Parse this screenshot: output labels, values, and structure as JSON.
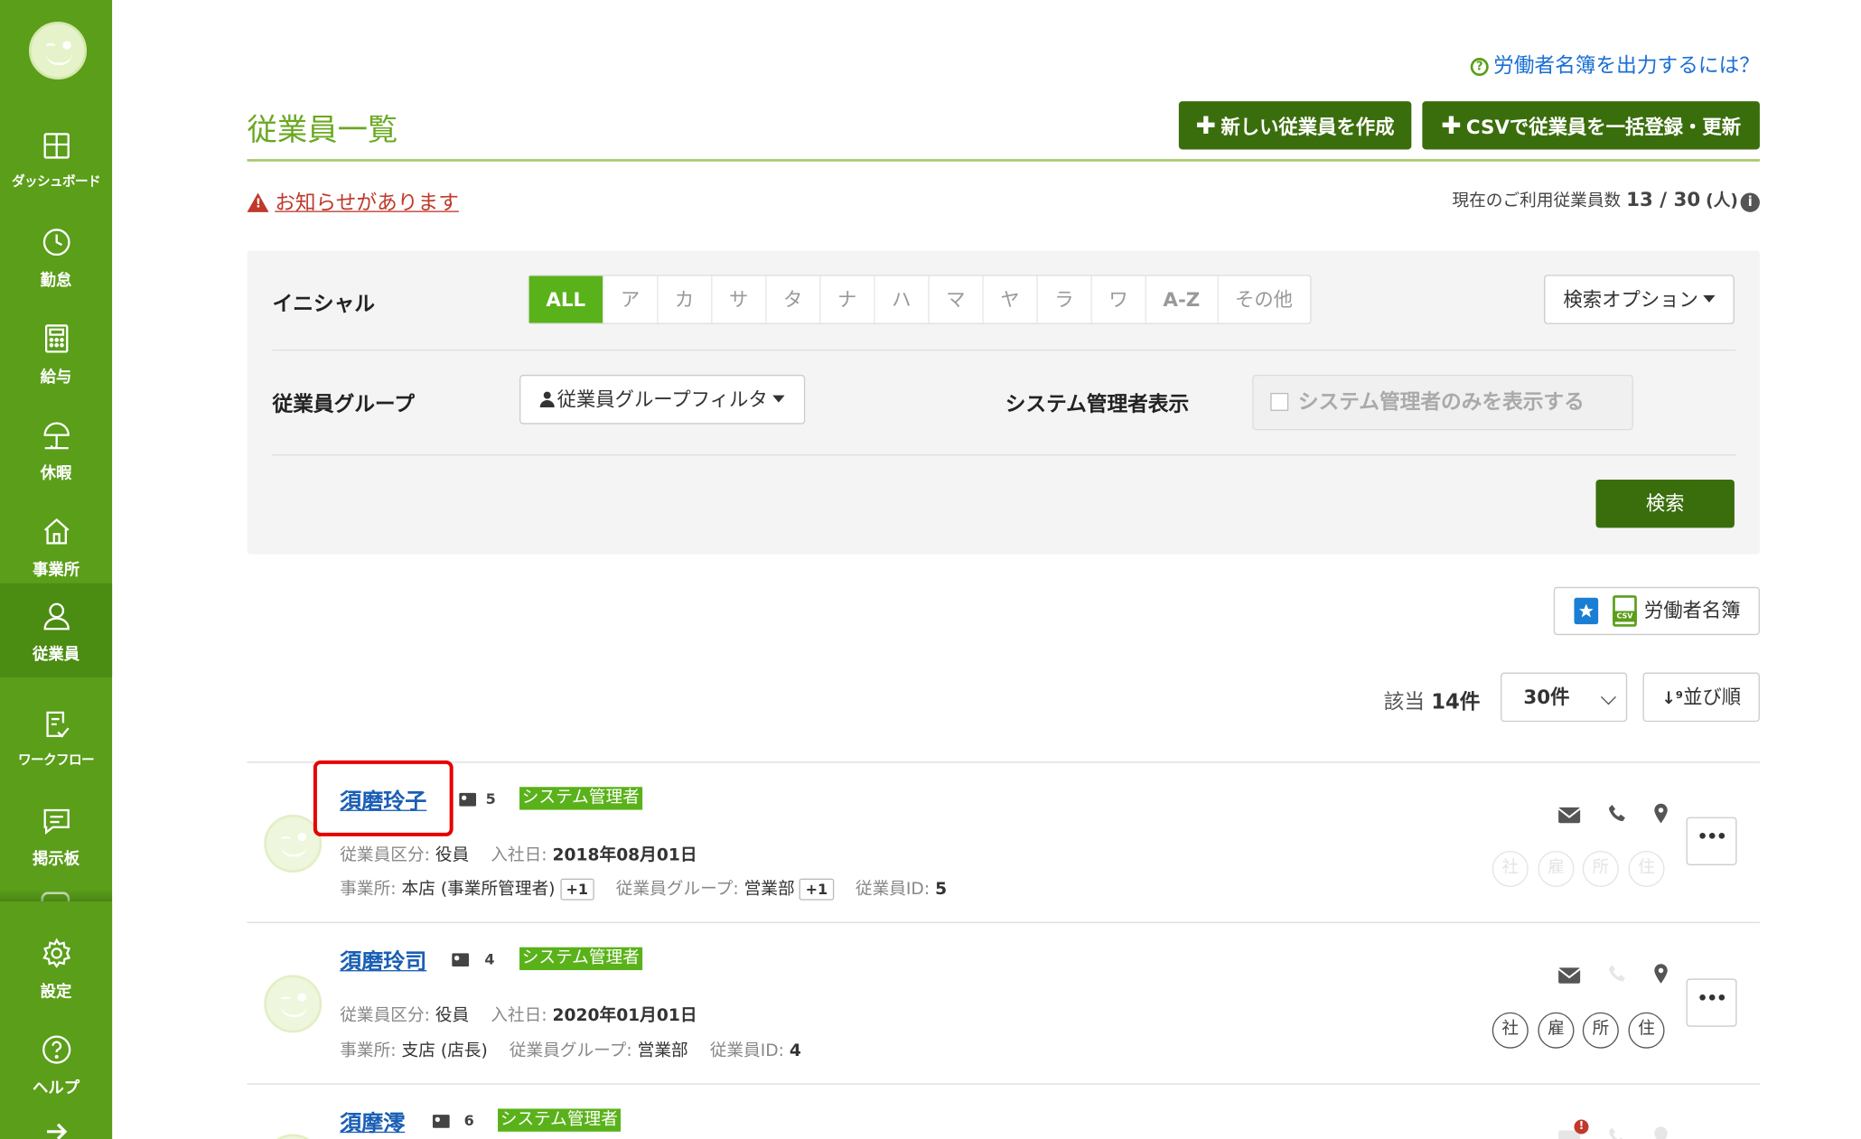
{
  "sidebar": {
    "items": [
      {
        "label": "ダッシュボード",
        "icon": "dashboard-icon"
      },
      {
        "label": "勤怠",
        "icon": "clock-icon"
      },
      {
        "label": "給与",
        "icon": "calculator-icon"
      },
      {
        "label": "休暇",
        "icon": "umbrella-icon"
      },
      {
        "label": "事業所",
        "icon": "home-icon"
      },
      {
        "label": "従業員",
        "icon": "person-icon",
        "active": true
      },
      {
        "label": "ワークフロー",
        "icon": "document-check-icon"
      },
      {
        "label": "掲示板",
        "icon": "message-icon"
      }
    ],
    "bottom": [
      {
        "label": "設定",
        "icon": "gear-icon"
      },
      {
        "label": "ヘルプ",
        "icon": "question-icon"
      }
    ],
    "accent": "#5a9e1a"
  },
  "header": {
    "help_link": "労働者名簿を出力するには？",
    "title": "従業員一覧",
    "new_button": "新しい従業員を作成",
    "csv_button": "CSVで従業員を一括登録・更新",
    "notice": "お知らせがあります",
    "usage_prefix": "現在のご利用従業員数",
    "usage_value": "13 / 30",
    "usage_unit": "(人)"
  },
  "filters": {
    "initial_label": "イニシャル",
    "initials": [
      "ALL",
      "ア",
      "カ",
      "サ",
      "タ",
      "ナ",
      "ハ",
      "マ",
      "ヤ",
      "ラ",
      "ワ",
      "A-Z",
      "その他"
    ],
    "selected_initial": "ALL",
    "search_options": "検索オプション",
    "group_label": "従業員グループ",
    "group_filter": "従業員グループフィルタ",
    "admin_label": "システム管理者表示",
    "admin_checkbox": "システム管理者のみを表示する",
    "search_button": "検索"
  },
  "list": {
    "roster_button": "労働者名簿",
    "csv_tag": "CSV",
    "count_prefix": "該当",
    "count_value": "14件",
    "per_page": "30件",
    "sort_button": "並び順",
    "labels": {
      "category": "従業員区分:",
      "joined": "入社日:",
      "office": "事業所:",
      "group": "従業員グループ:",
      "emp_id": "従業員ID:"
    },
    "chips": [
      "社",
      "雇",
      "所",
      "住"
    ],
    "employees": [
      {
        "name": "須磨玲子",
        "card_no": "5",
        "badge": "システム管理者",
        "category": "役員",
        "joined": "2018年08月01日",
        "office": "本店 (事業所管理者)",
        "office_more": "+1",
        "group": "営業部",
        "group_more": "+1",
        "emp_id": "5",
        "phone_enabled": true,
        "chips_enabled": false
      },
      {
        "name": "須磨玲司",
        "card_no": "4",
        "badge": "システム管理者",
        "category": "役員",
        "joined": "2020年01月01日",
        "office": "支店 (店長)",
        "office_more": "",
        "group": "営業部",
        "group_more": "",
        "emp_id": "4",
        "phone_enabled": false,
        "chips_enabled": true
      },
      {
        "name": "須摩澪",
        "card_no": "6",
        "badge": "システム管理者",
        "mail_alert": true
      }
    ],
    "more_button": "•••"
  }
}
